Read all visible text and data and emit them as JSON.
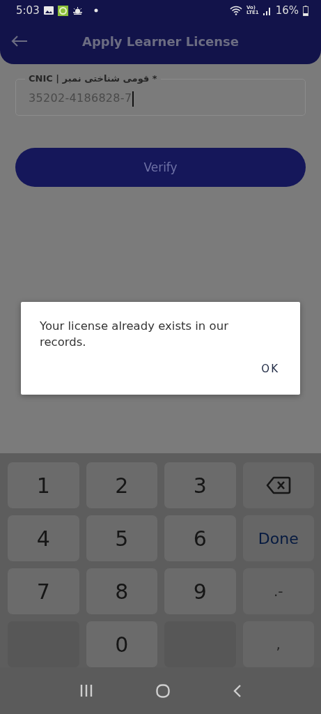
{
  "status_bar": {
    "time": "5:03",
    "volte_top": "Vo)",
    "volte_bottom": "LTE1",
    "battery": "16%"
  },
  "app_bar": {
    "title": "Apply Learner License"
  },
  "cnic_field": {
    "label": "CNIC | قومی شناختی نمبر *",
    "value": "35202-4186828-7"
  },
  "verify_button": {
    "label": "Verify"
  },
  "dialog": {
    "message": "Your license already exists in our records.",
    "button": "OK"
  },
  "keyboard": {
    "keys": [
      {
        "kind": "digit",
        "label": "1"
      },
      {
        "kind": "digit",
        "label": "2"
      },
      {
        "kind": "digit",
        "label": "3"
      },
      {
        "kind": "backspace"
      },
      {
        "kind": "digit",
        "label": "4"
      },
      {
        "kind": "digit",
        "label": "5"
      },
      {
        "kind": "digit",
        "label": "6"
      },
      {
        "kind": "done",
        "label": "Done"
      },
      {
        "kind": "digit",
        "label": "7"
      },
      {
        "kind": "digit",
        "label": "8"
      },
      {
        "kind": "digit",
        "label": "9"
      },
      {
        "kind": "symbol",
        "label": ".-"
      },
      {
        "kind": "blank"
      },
      {
        "kind": "digit",
        "label": "0"
      },
      {
        "kind": "blank"
      },
      {
        "kind": "symbol",
        "label": ","
      }
    ]
  }
}
